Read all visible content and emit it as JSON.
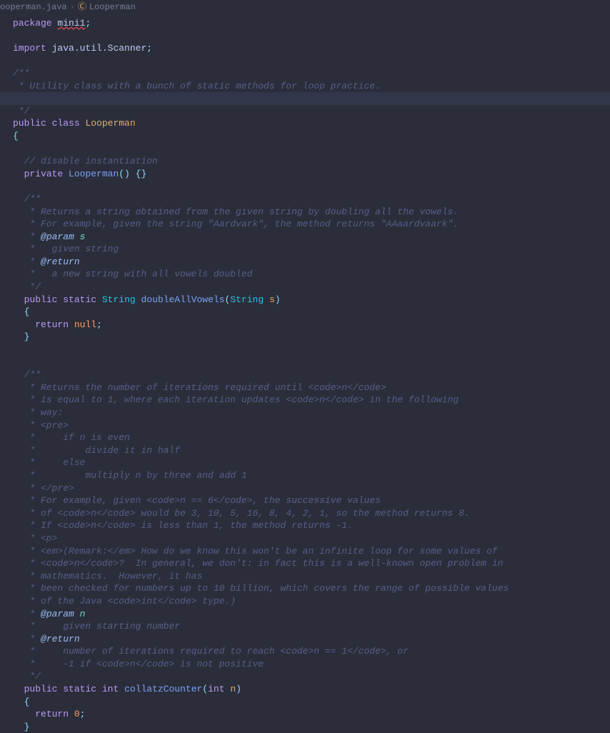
{
  "breadcrumb": {
    "file": "ooperman.java",
    "sep": "›",
    "class": "Looperman"
  },
  "lines": {
    "l1_package": "package",
    "l1_pkg": "mini1",
    "l1_semi": ";",
    "l3_import": "import",
    "l3_path": "java.util.Scanner",
    "l3_semi": ";",
    "l5": "/**",
    "l6": " * Utility class with a bunch of static methods for loop practice.",
    "l7": "",
    "l8": " */",
    "l9_pub": "public",
    "l9_cls": "class",
    "l9_name": "Looperman",
    "l10": "{",
    "l12": "  // disable instantiation",
    "l13_priv": "private",
    "l13_name": "Looperman",
    "l13_rest": "() {}",
    "l15": "  /**",
    "l16": "   * Returns a string obtained from the given string by doubling all the vowels.",
    "l17": "   * For example, given the string \"Aardvark\", the method returns \"AAaardvaark\".",
    "l18a": "   * ",
    "l18tag": "@param",
    "l18v": "s",
    "l19": "   *   given string",
    "l20a": "   * ",
    "l20tag": "@return",
    "l21": "   *   a new string with all vowels doubled",
    "l22": "   */",
    "l23_pub": "public",
    "l23_st": "static",
    "l23_ty": "String",
    "l23_fn": "doubleAllVowels",
    "l23_pty": "String",
    "l23_prm": "s",
    "l24": "  {",
    "l25_ret": "return",
    "l25_null": "null",
    "l25_semi": ";",
    "l26": "  }",
    "l30": "  /**",
    "l31": "   * Returns the number of iterations required until <code>n</code>",
    "l32": "   * is equal to 1, where each iteration updates <code>n</code> in the following",
    "l33": "   * way:",
    "l34": "   * <pre>",
    "l35": "   *     if n is even",
    "l36": "   *         divide it in half",
    "l37": "   *     else",
    "l38": "   *         multiply n by three and add 1",
    "l39": "   * </pre>",
    "l40": "   * For example, given <code>n == 6</code>, the successive values",
    "l41": "   * of <code>n</code> would be 3, 10, 5, 16, 8, 4, 2, 1, so the method returns 8.",
    "l42": "   * If <code>n</code> is less than 1, the method returns -1.",
    "l43": "   * <p>",
    "l44": "   * <em>(Remark:</em> How do we know this won't be an infinite loop for some values of",
    "l45": "   * <code>n</code>?  In general, we don't: in fact this is a well-known open problem in",
    "l46": "   * mathematics.  However, it has",
    "l47": "   * been checked for numbers up to 10 billion, which covers the range of possible values",
    "l48": "   * of the Java <code>int</code> type.)",
    "l49a": "   * ",
    "l49tag": "@param",
    "l49v": "n",
    "l50": "   *     given starting number",
    "l51a": "   * ",
    "l51tag": "@return",
    "l52": "   *     number of iterations required to reach <code>n == 1</code>, or",
    "l53": "   *     -1 if <code>n</code> is not positive",
    "l54": "   */",
    "l55_pub": "public",
    "l55_st": "static",
    "l55_ty": "int",
    "l55_fn": "collatzCounter",
    "l55_pty": "int",
    "l55_prm": "n",
    "l56": "  {",
    "l57_ret": "return",
    "l57_zero": "0",
    "l57_semi": ";",
    "l58": "  }"
  }
}
